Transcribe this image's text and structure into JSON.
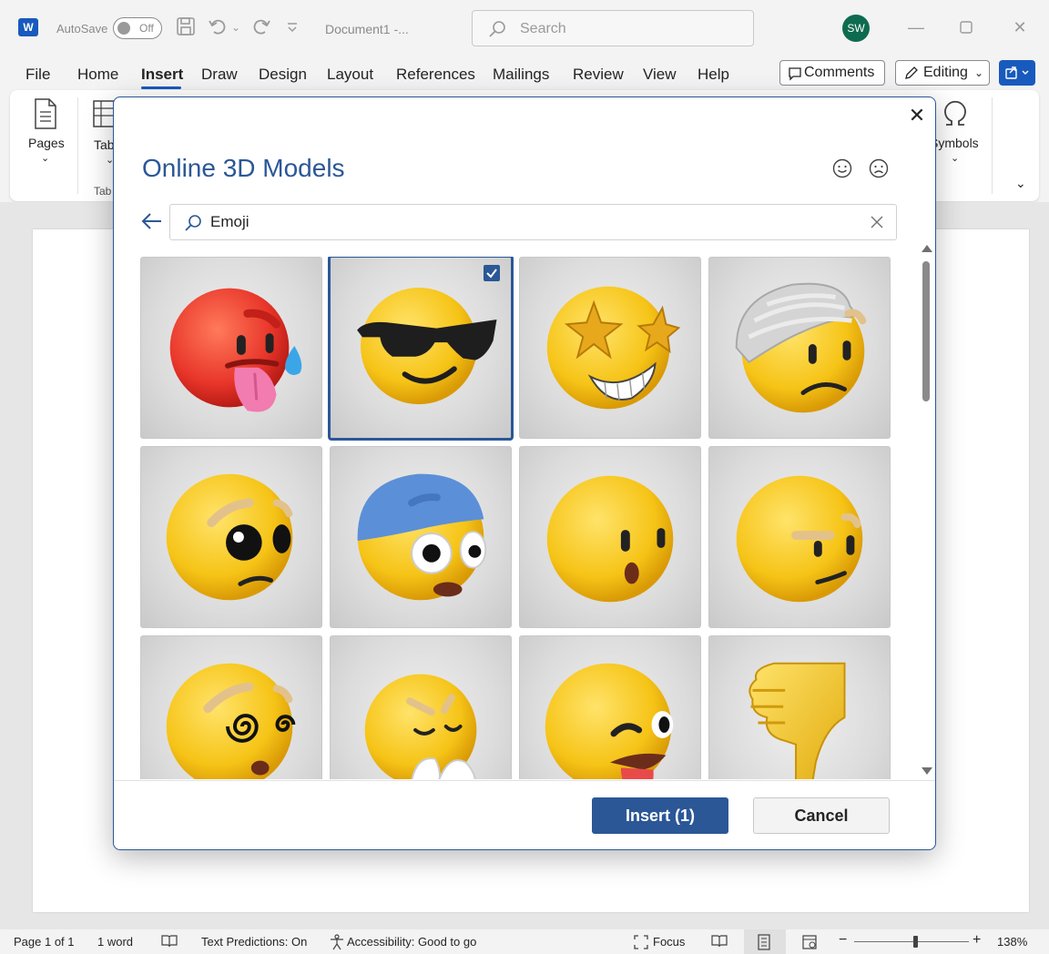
{
  "titlebar": {
    "app_logo_letter": "W",
    "autosave_label": "AutoSave",
    "autosave_state": "Off",
    "document_title": "Document1  -...",
    "search_placeholder": "Search",
    "avatar_initials": "SW"
  },
  "menu": {
    "tabs": [
      "File",
      "Home",
      "Insert",
      "Draw",
      "Design",
      "Layout",
      "References",
      "Mailings",
      "Review",
      "View",
      "Help"
    ],
    "active_tab": "Insert",
    "comments_label": "Comments",
    "editing_label": "Editing"
  },
  "ribbon": {
    "pages_label": "Pages",
    "tables_label": "Tab",
    "tables_group_label": "Tab",
    "symbols_label": "Symbols"
  },
  "dialog": {
    "title": "Online 3D Models",
    "search_value": "Emoji",
    "insert_label": "Insert (1)",
    "cancel_label": "Cancel",
    "selected_index": 1,
    "models": [
      {
        "icon": "hot-face-emoji"
      },
      {
        "icon": "sunglasses-emoji"
      },
      {
        "icon": "star-struck-emoji"
      },
      {
        "icon": "bandaged-head-emoji"
      },
      {
        "icon": "worried-emoji"
      },
      {
        "icon": "shocked-cap-emoji"
      },
      {
        "icon": "surprised-emoji"
      },
      {
        "icon": "skeptical-emoji"
      },
      {
        "icon": "dizzy-face-emoji"
      },
      {
        "icon": "laughing-hands-emoji"
      },
      {
        "icon": "winking-tongue-emoji"
      },
      {
        "icon": "thumbs-down-emoji"
      }
    ]
  },
  "status": {
    "page": "Page 1 of 1",
    "words": "1 word",
    "text_predictions": "Text Predictions: On",
    "accessibility": "Accessibility: Good to go",
    "focus": "Focus",
    "zoom": "138%"
  },
  "colors": {
    "accent": "#2b5797",
    "word_blue": "#185abd",
    "emoji_yellow": "#f6c417"
  }
}
